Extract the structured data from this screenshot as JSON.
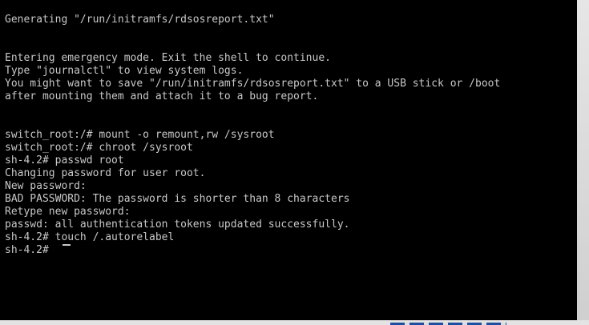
{
  "console": {
    "lines": [
      "Generating \"/run/initramfs/rdsosreport.txt\"",
      "",
      "",
      "Entering emergency mode. Exit the shell to continue.",
      "Type \"journalctl\" to view system logs.",
      "You might want to save \"/run/initramfs/rdsosreport.txt\" to a USB stick or /boot",
      "after mounting them and attach it to a bug report.",
      "",
      "",
      "switch_root:/# mount -o remount,rw /sysroot",
      "switch_root:/# chroot /sysroot",
      "sh-4.2# passwd root",
      "Changing password for user root.",
      "New password:",
      "BAD PASSWORD: The password is shorter than 8 characters",
      "Retype new password:",
      "passwd: all authentication tokens updated successfully.",
      "sh-4.2# touch /.autorelabel",
      "sh-4.2# "
    ]
  }
}
